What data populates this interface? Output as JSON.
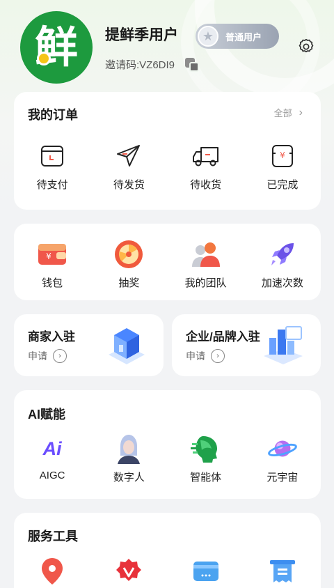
{
  "profile": {
    "avatar_char": "鲜",
    "username": "提鲜季用户",
    "badge": "普通用户",
    "invite": "邀请码:VZ6DI9"
  },
  "orders": {
    "title": "我的订单",
    "all": "全部",
    "items": [
      {
        "label": "待支付",
        "icon": "wallet-clock-icon"
      },
      {
        "label": "待发货",
        "icon": "send-icon"
      },
      {
        "label": "待收货",
        "icon": "truck-icon"
      },
      {
        "label": "已完成",
        "icon": "receipt-icon"
      }
    ]
  },
  "features": {
    "items": [
      {
        "label": "钱包",
        "icon": "wallet-icon"
      },
      {
        "label": "抽奖",
        "icon": "lottery-wheel-icon"
      },
      {
        "label": "我的团队",
        "icon": "team-icon"
      },
      {
        "label": "加速次数",
        "icon": "rocket-icon"
      }
    ]
  },
  "merchant": {
    "title": "商家入驻",
    "apply": "申请"
  },
  "brand": {
    "title": "企业/品牌入驻",
    "apply": "申请"
  },
  "ai": {
    "title": "AI赋能",
    "items": [
      {
        "label": "AIGC",
        "icon": "ai-icon",
        "mark": "Ai"
      },
      {
        "label": "数字人",
        "icon": "digital-human-icon"
      },
      {
        "label": "智能体",
        "icon": "agent-head-icon"
      },
      {
        "label": "元宇宙",
        "icon": "planet-icon"
      }
    ]
  },
  "services": {
    "title": "服务工具",
    "items": [
      {
        "icon": "location-pin-icon"
      },
      {
        "icon": "v-badge-icon"
      },
      {
        "icon": "card-icon"
      },
      {
        "icon": "invoice-icon"
      }
    ]
  },
  "colors": {
    "brand_green": "#1d9a3e",
    "accent_red": "#f05a4a",
    "badge_gray": "#9aa3b2"
  }
}
